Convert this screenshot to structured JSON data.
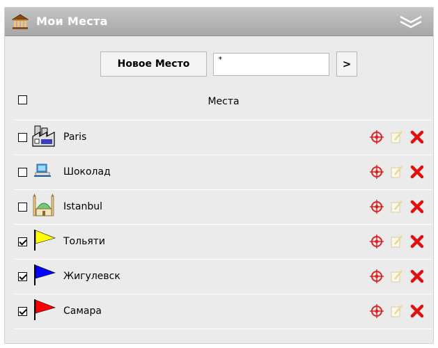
{
  "window": {
    "title": "Мои Места",
    "title_icon": "building-icon",
    "collapse_icon": "double-chevron-down-icon"
  },
  "toolbar": {
    "new_place_label": "Новое Место",
    "search_value": "*",
    "go_label": ">"
  },
  "table": {
    "header_label": "Места",
    "header_checked": false,
    "rows": [
      {
        "label": "Paris",
        "checked": false,
        "icon": "factory-icon"
      },
      {
        "label": "Шоколад",
        "checked": false,
        "icon": "computer-icon"
      },
      {
        "label": "Istanbul",
        "checked": false,
        "icon": "mosque-icon"
      },
      {
        "label": "Тольяти",
        "checked": true,
        "icon": "yellow-flag-icon",
        "color": "#ffff00"
      },
      {
        "label": "Жигулевск",
        "checked": true,
        "icon": "blue-flag-icon",
        "color": "#0000ff"
      },
      {
        "label": "Самара",
        "checked": true,
        "icon": "red-flag-icon",
        "color": "#ff0000"
      }
    ],
    "actions": [
      "locate-icon",
      "edit-icon",
      "delete-icon"
    ]
  }
}
